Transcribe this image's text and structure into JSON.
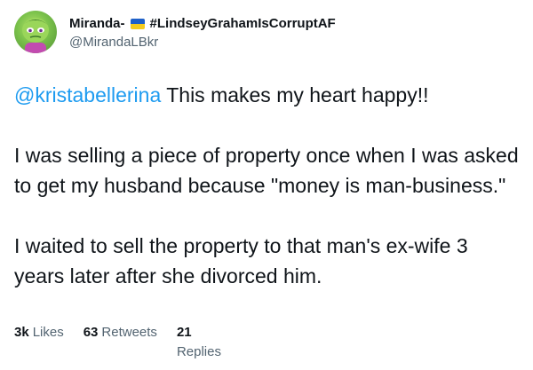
{
  "user": {
    "display_name": "Miranda-",
    "hashtag": "#LindseyGrahamIsCorruptAF",
    "handle": "@MirandaLBkr",
    "flag_colors": [
      "#1f61c8",
      "#f5cc1d"
    ]
  },
  "tweet": {
    "mention": "@kristabellerina",
    "line1_rest": " This makes my heart happy!!",
    "paragraph2": "I was selling a piece of property once when I was asked to get my husband because \"money is man-business.\"",
    "paragraph3": "I waited to sell the property to that man's ex-wife 3 years later after she divorced him."
  },
  "stats": {
    "likes_count": "3k",
    "likes_label": "Likes",
    "retweets_count": "63",
    "retweets_label": "Retweets",
    "replies_count": "21",
    "replies_label": "Replies"
  },
  "colors": {
    "mention": "#1d9bf0",
    "text": "#0f1419",
    "secondary": "#536471"
  }
}
